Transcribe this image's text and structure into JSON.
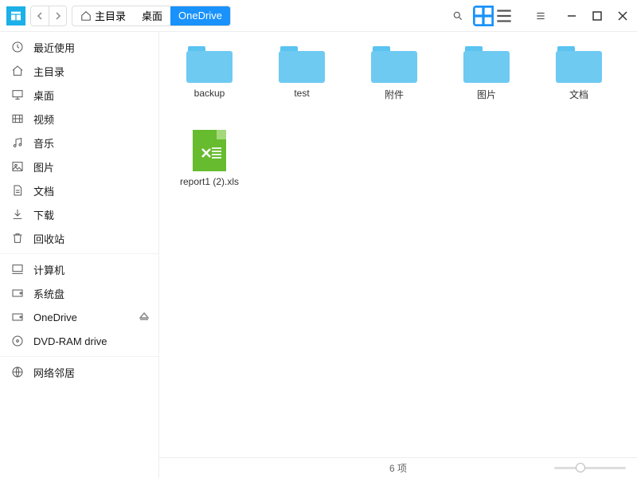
{
  "breadcrumb": {
    "home": "主目录",
    "desktop": "桌面",
    "current": "OneDrive"
  },
  "sidebar": {
    "group1": [
      {
        "icon": "clock",
        "label": "最近使用"
      },
      {
        "icon": "home",
        "label": "主目录"
      },
      {
        "icon": "desktop",
        "label": "桌面"
      },
      {
        "icon": "video",
        "label": "视频"
      },
      {
        "icon": "music",
        "label": "音乐"
      },
      {
        "icon": "picture",
        "label": "图片"
      },
      {
        "icon": "document",
        "label": "文档"
      },
      {
        "icon": "download",
        "label": "下载"
      },
      {
        "icon": "trash",
        "label": "回收站"
      }
    ],
    "group2": [
      {
        "icon": "computer",
        "label": "计算机"
      },
      {
        "icon": "disk",
        "label": "系统盘"
      },
      {
        "icon": "disk",
        "label": "OneDrive",
        "eject": true
      },
      {
        "icon": "disc",
        "label": "DVD-RAM drive"
      }
    ],
    "group3": [
      {
        "icon": "network",
        "label": "网络邻居"
      }
    ]
  },
  "items": [
    {
      "type": "folder",
      "label": "backup"
    },
    {
      "type": "folder",
      "label": "test"
    },
    {
      "type": "folder",
      "label": "附件"
    },
    {
      "type": "folder",
      "label": "图片"
    },
    {
      "type": "folder",
      "label": "文档"
    },
    {
      "type": "xls",
      "label": "report1 (2).xls"
    }
  ],
  "status": "6 项"
}
